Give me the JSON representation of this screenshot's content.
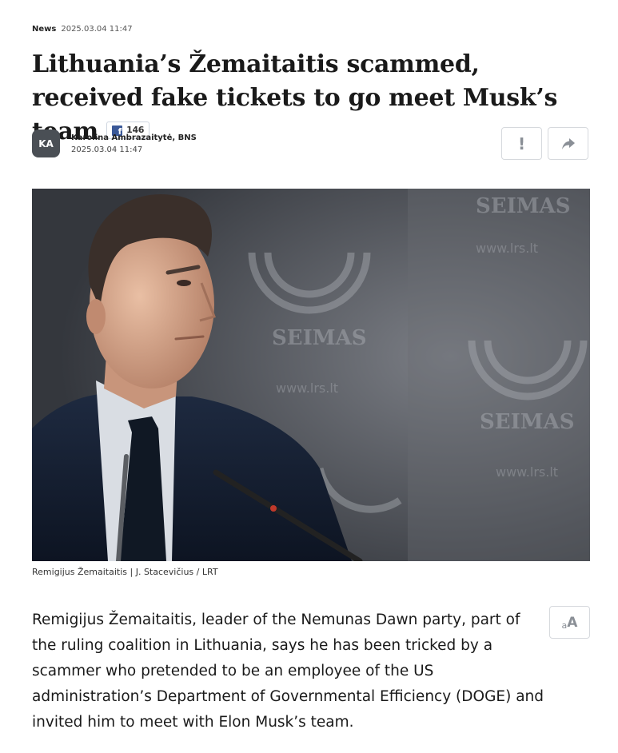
{
  "meta": {
    "category": "News",
    "date": "2025.03.04 11:47"
  },
  "article": {
    "title": "Lithuania’s Žemaitaitis scammed, received fake tickets to go meet Musk’s team",
    "facebook_shares": "146",
    "author": {
      "initials": "KA",
      "name": "Karolina Ambrazaitytė, BNS",
      "date": "2025.03.04 11:47"
    },
    "image_caption": "Remigijus Žemaitaitis | J. Stacevičius / LRT",
    "image_backdrop_text": [
      "SEIMAS",
      "www.lrs.lt"
    ],
    "lead": "Remigijus Žemaitaitis, leader of the Nemunas Dawn party, part of the ruling coalition in Lithuania, says he has been tricked by a scammer who pretended to be an employee of the US administration’s Department of Governmental Efficiency (DOGE) and invited him to meet with Elon Musk’s team."
  },
  "actions": {
    "report_icon": "exclamation-icon",
    "share_icon": "share-arrow-icon",
    "font_size_small": "a",
    "font_size_big": "A"
  },
  "colors": {
    "facebook": "#3b5998",
    "avatar_bg": "#4a4f55",
    "border": "#d6d9dd"
  }
}
